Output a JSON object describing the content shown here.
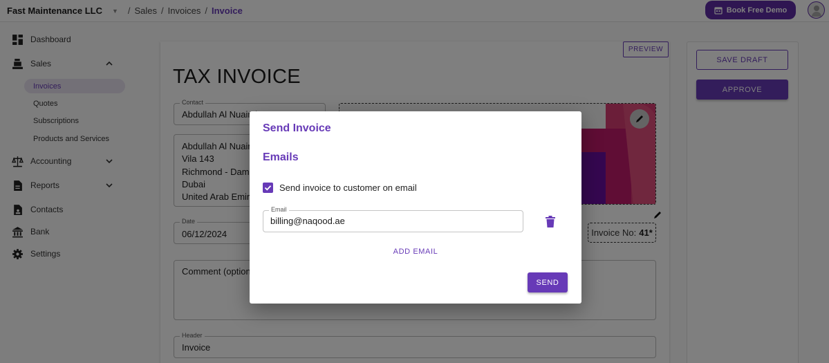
{
  "topbar": {
    "company": "Fast Maintenance LLC",
    "breadcrumb": [
      "Sales",
      "Invoices",
      "Invoice"
    ],
    "demo_button": "Book Free Demo"
  },
  "sidebar": {
    "items": [
      {
        "label": "Dashboard",
        "icon": "dashboard-icon"
      },
      {
        "label": "Sales",
        "icon": "cash-register-icon",
        "expanded": true,
        "children": [
          "Invoices",
          "Quotes",
          "Subscriptions",
          "Products and Services"
        ],
        "active_child": "Invoices"
      },
      {
        "label": "Accounting",
        "icon": "scale-icon",
        "expanded": false
      },
      {
        "label": "Reports",
        "icon": "report-icon",
        "expanded": false
      },
      {
        "label": "Contacts",
        "icon": "contact-icon"
      },
      {
        "label": "Bank",
        "icon": "bank-icon"
      },
      {
        "label": "Settings",
        "icon": "gear-icon"
      }
    ]
  },
  "invoice": {
    "preview_label": "PREVIEW",
    "title": "TAX INVOICE",
    "contact_label": "Contact",
    "contact_value": "Abdullah Al Nuaimi",
    "address_lines": [
      "Abdullah Al Nuaimi",
      "Vila 143",
      "Richmond - Damac Hills",
      "Dubai",
      "United Arab Emirates"
    ],
    "date_label": "Date",
    "date_value": "06/12/2024",
    "comment_placeholder": "Comment (optional)",
    "header_label": "Header",
    "header_value": "Invoice",
    "invoice_no_label": "Invoice No:",
    "invoice_no_value": "41*"
  },
  "actions": {
    "save_draft": "SAVE DRAFT",
    "approve": "APPROVE"
  },
  "dialog": {
    "title": "Send Invoice",
    "section": "Emails",
    "checkbox_label": "Send invoice to customer on email",
    "checkbox_checked": true,
    "email_label": "Email",
    "email_value": "billing@naqood.ae",
    "add_email": "ADD EMAIL",
    "send": "SEND"
  },
  "colors": {
    "accent": "#673ab7",
    "brand_dark": "#5e2ca5"
  }
}
